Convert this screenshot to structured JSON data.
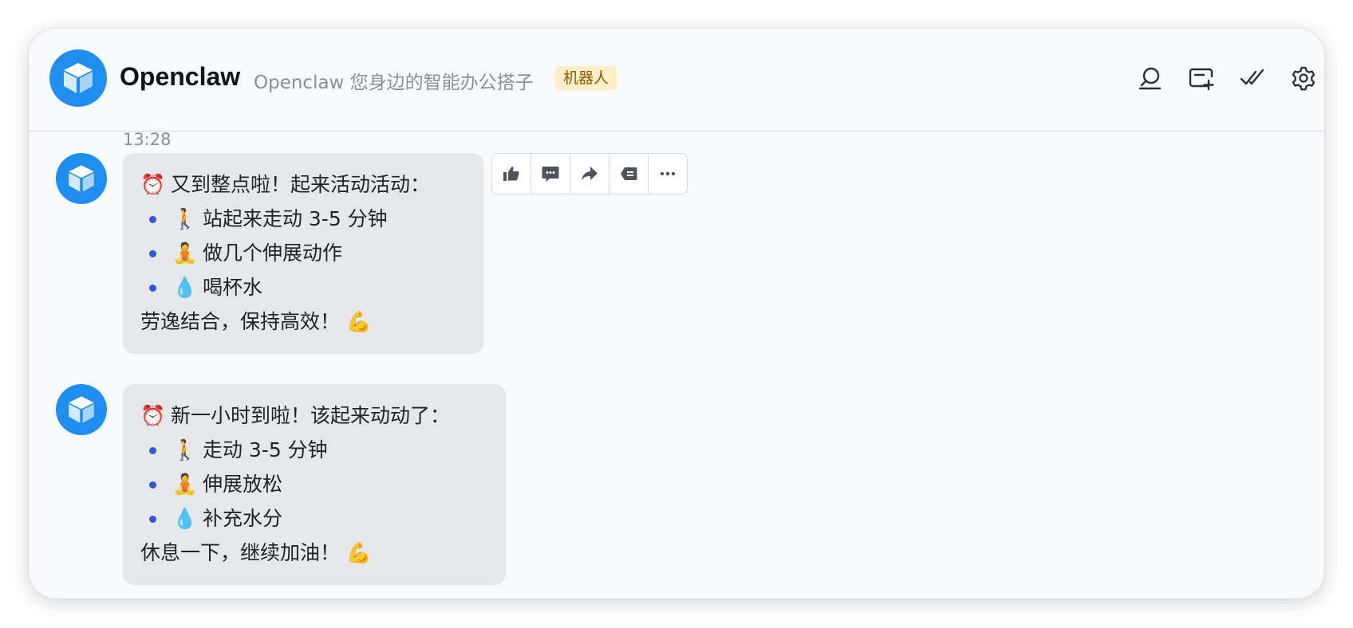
{
  "header": {
    "title": "Openclaw",
    "subtitle": "Openclaw 您身边的智能办公搭子",
    "badge": "机器人"
  },
  "colors": {
    "accent": "#1e8ff1",
    "bubble": "#e6e7e9",
    "bullet": "#3356d9",
    "badge_bg": "#fcefc8",
    "badge_text": "#8a5a05"
  },
  "header_icons": [
    "search-icon",
    "new-topic-icon",
    "mark-done-icon",
    "settings-icon"
  ],
  "toolbar_icons": [
    "thumbs-up-icon",
    "comment-icon",
    "forward-icon",
    "quote-icon",
    "more-icon"
  ],
  "timestamp": "13:28",
  "messages": [
    {
      "intro": "又到整点啦！起来活动活动：",
      "items": [
        "站起来走动 3-5 分钟",
        "做几个伸展动作",
        "喝杯水"
      ],
      "outro": "劳逸结合，保持高效！",
      "emojis": {
        "intro": "⏰",
        "items": [
          "🚶",
          "🧘",
          "💧"
        ],
        "outro": "💪"
      }
    },
    {
      "intro": "新一小时到啦！该起来动动了：",
      "items": [
        "走动 3-5 分钟",
        "伸展放松",
        "补充水分"
      ],
      "outro": "休息一下，继续加油！",
      "emojis": {
        "intro": "⏰",
        "items": [
          "🚶",
          "🧘",
          "💧"
        ],
        "outro": "💪"
      }
    }
  ]
}
